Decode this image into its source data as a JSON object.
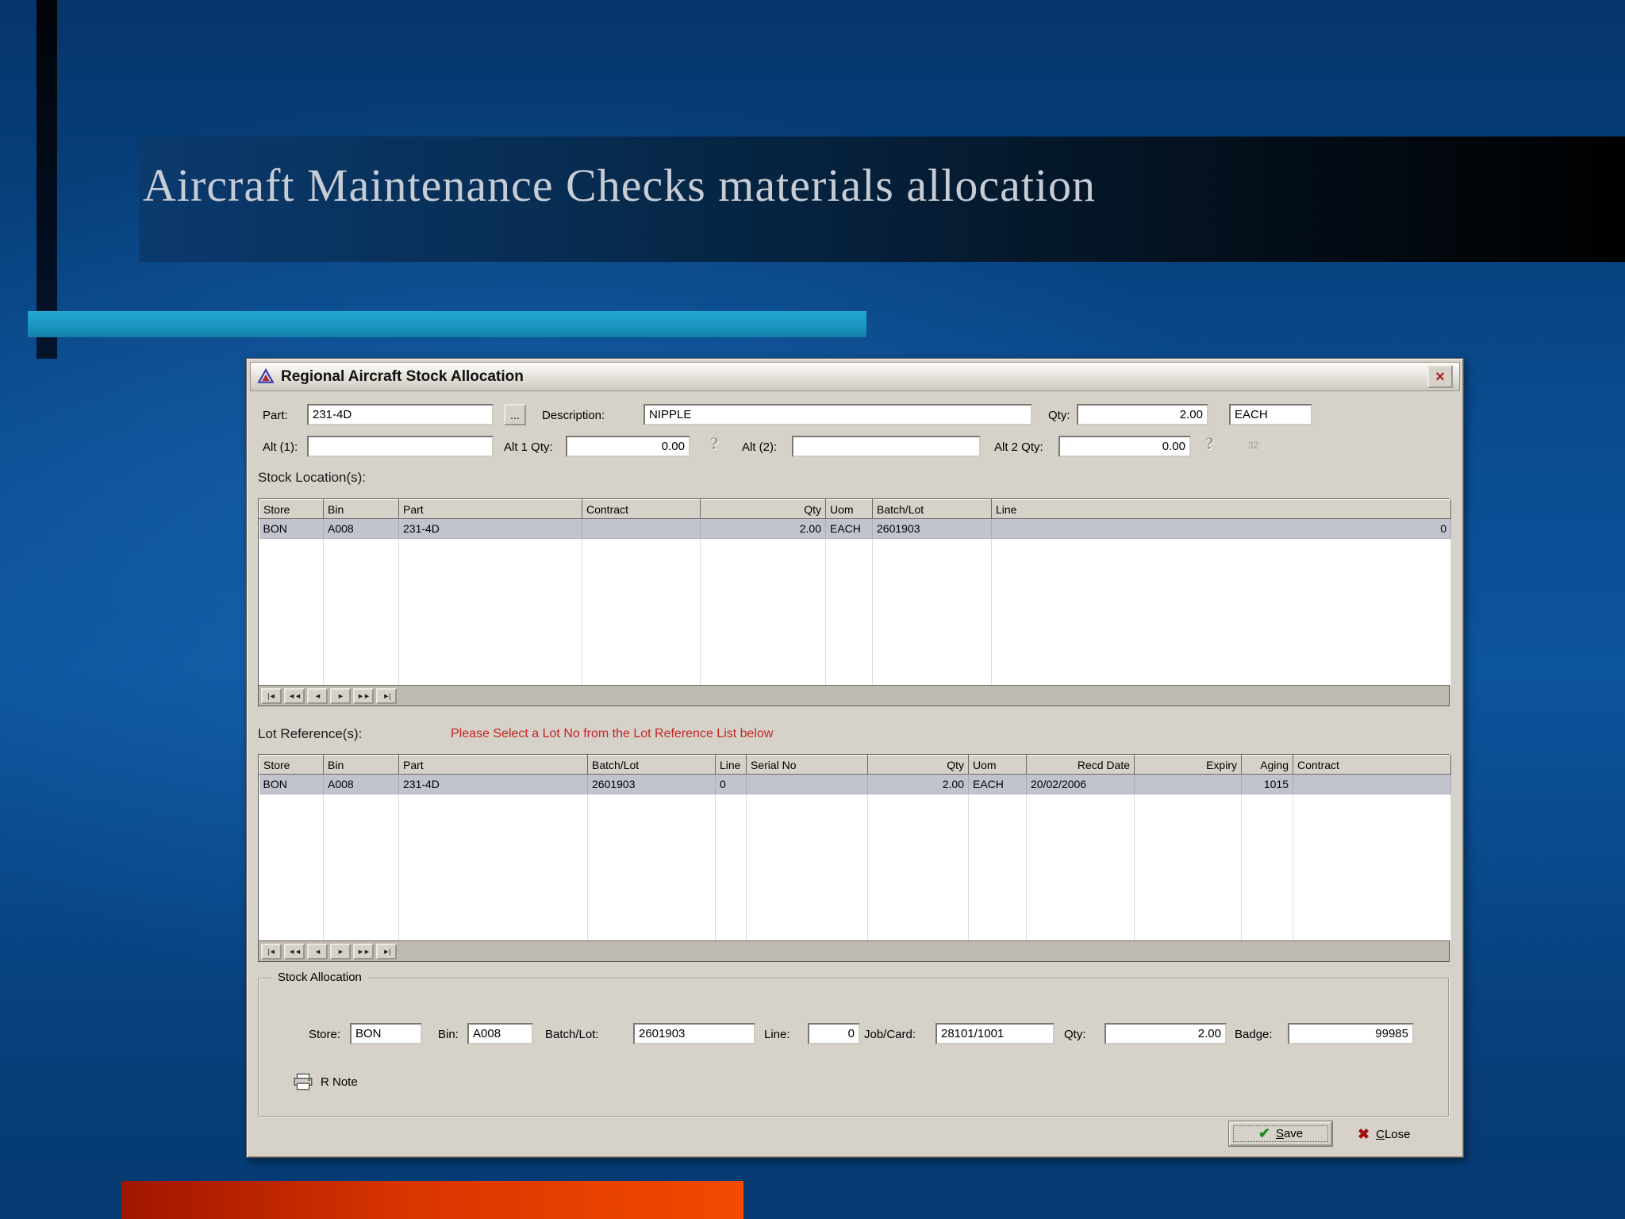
{
  "slide": {
    "title": "Aircraft Maintenance Checks materials allocation"
  },
  "window": {
    "title": "Regional Aircraft Stock Allocation",
    "close_glyph": "×"
  },
  "form": {
    "part_label": "Part:",
    "part_value": "231-4D",
    "browse_label": "...",
    "description_label": "Description:",
    "description_value": "NIPPLE",
    "qty_label": "Qty:",
    "qty_value": "2.00",
    "uom_value": "EACH",
    "alt1_label": "Alt (1):",
    "alt1_qty_label": "Alt 1 Qty:",
    "alt1_qty_value": "0.00",
    "alt2_label": "Alt (2):",
    "alt2_qty_label": "Alt 2 Qty:",
    "alt2_qty_value": "0.00",
    "help_glyph": "?",
    "faint_text": "32"
  },
  "stock_locations": {
    "section_label": "Stock Location(s):",
    "columns": [
      "Store",
      "Bin",
      "Part",
      "Contract",
      "Qty",
      "Uom",
      "Batch/Lot",
      "Line"
    ],
    "rows": [
      [
        "BON",
        "A008",
        "231-4D",
        "",
        "2.00",
        "EACH",
        "2601903",
        "0"
      ]
    ]
  },
  "lot_references": {
    "section_label": "Lot Reference(s):",
    "notice": "Please Select a Lot No from the Lot Reference List below",
    "columns": [
      "Store",
      "Bin",
      "Part",
      "Batch/Lot",
      "Line",
      "Serial No",
      "Qty",
      "Uom",
      "Recd Date",
      "Expiry",
      "Aging",
      "Contract"
    ],
    "rows": [
      [
        "BON",
        "A008",
        "231-4D",
        "2601903",
        "0",
        "",
        "2.00",
        "EACH",
        "20/02/2006",
        "",
        "1015",
        ""
      ]
    ]
  },
  "nav": {
    "first": "|◄",
    "fast_prev": "◄◄",
    "prev": "◄",
    "next": "►",
    "fast_next": "►►",
    "last": "►|"
  },
  "stock_allocation": {
    "group_label": "Stock Allocation",
    "store_label": "Store:",
    "store_value": "BON",
    "bin_label": "Bin:",
    "bin_value": "A008",
    "batch_label": "Batch/Lot:",
    "batch_value": "2601903",
    "line_label": "Line:",
    "line_value": "0",
    "jobcard_label": "Job/Card:",
    "jobcard_value": "28101/1001",
    "qty_label": "Qty:",
    "qty_value": "2.00",
    "badge_label": "Badge:",
    "badge_value": "99985",
    "rnote_label": "R Note"
  },
  "buttons": {
    "save_check": "✔",
    "save_key": "S",
    "save_rest": "ave",
    "close_x": "✖",
    "close_key": "C",
    "close_rest": "Lose"
  }
}
